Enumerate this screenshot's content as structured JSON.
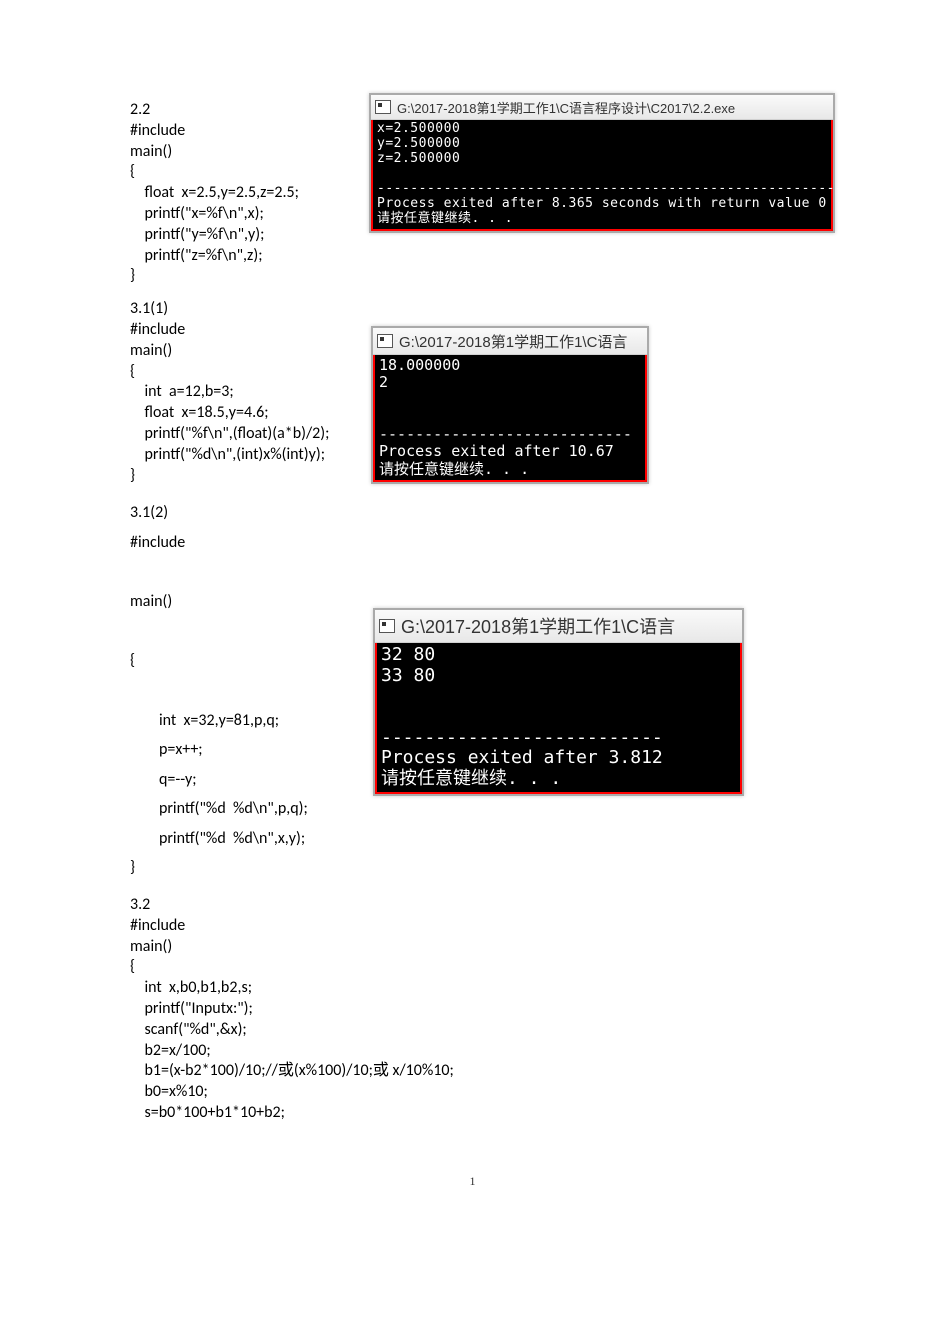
{
  "pageNumber": "1",
  "blocks": {
    "b1": {
      "title": "2.2",
      "code": "#include\nmain()\n{\n    float  x=2.5,y=2.5,z=2.5;\n    printf(\"x=%f\\n\",x);\n    printf(\"y=%f\\n\",y);\n    printf(\"z=%f\\n\",z);\n}"
    },
    "b2": {
      "title": "3.1(1)",
      "code": "#include\nmain()\n{\n    int  a=12,b=3;\n    float  x=18.5,y=4.6;\n    printf(\"%f\\n\",(float)(a*b)/2);\n    printf(\"%d\\n\",(int)x%(int)y);\n}"
    },
    "b3": {
      "title": "3.1(2)",
      "code_l1": "#include",
      "code_l2": "main()",
      "code_l3": "{",
      "code_l4": "        int  x=32,y=81,p,q;",
      "code_l5": "        p=x++;",
      "code_l6": "        q=--y;",
      "code_l7": "        printf(\"%d  %d\\n\",p,q);",
      "code_l8": "        printf(\"%d  %d\\n\",x,y);",
      "code_l9": "}"
    },
    "b4": {
      "title": "3.2",
      "code": "#include\nmain()\n{\n    int  x,b0,b1,b2,s;\n    printf(\"Inputx:\");\n    scanf(\"%d\",&x);\n    b2=x/100;\n    b1=(x-b2*100)/10;//或(x%100)/10;或 x/10%10;\n    b0=x%10;\n    s=b0*100+b1*10+b2;"
    }
  },
  "consoles": {
    "c1": {
      "title": " G:\\2017-2018第1学期工作1\\C语言程序设计\\C2017\\2.2.exe",
      "body": "x=2.500000\ny=2.500000\nz=2.500000\n\n--------------------------------------------------------\nProcess exited after 8.365 seconds with return value 0\n请按任意键继续. . ."
    },
    "c2": {
      "title": " G:\\2017-2018第1学期工作1\\C语言",
      "body": "18.000000\n2\n\n\n----------------------------\nProcess exited after 10.67\n请按任意键继续. . ."
    },
    "c3": {
      "title": " G:\\2017-2018第1学期工作1\\C语言",
      "body": "32 80\n33 80\n\n\n--------------------------\nProcess exited after 3.812\n请按任意键继续. . ."
    }
  }
}
